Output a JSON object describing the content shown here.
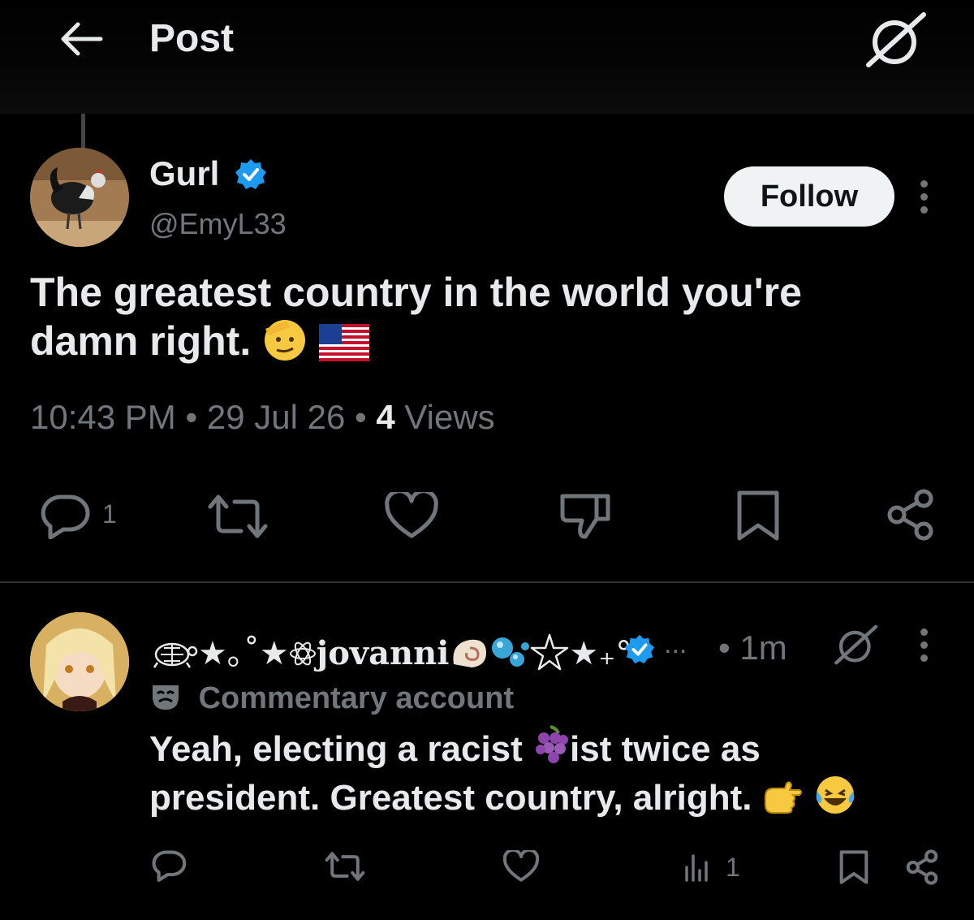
{
  "header": {
    "title": "Post",
    "back_icon": "arrow-left-icon",
    "grok_icon": "grok-icon"
  },
  "post": {
    "author_name": "Gurl",
    "handle": "@EmyL33",
    "verified": true,
    "follow_label": "Follow",
    "text_line1": "The greatest country in the world you're",
    "text_line2": "damn right.",
    "time": "10:43 PM",
    "date": "29 Jul 26",
    "views_count": "4",
    "views_label": "Views",
    "separator": "•",
    "reply_count": "1",
    "actions": [
      "reply-icon",
      "repost-icon",
      "like-icon",
      "dislike-icon",
      "bookmark-icon",
      "share-icon"
    ]
  },
  "reply": {
    "author_name": "jovanni",
    "name_prefix": "★｡˚★",
    "name_suffix": "★₊°",
    "ellipsis": "...",
    "time": "• 1m",
    "badge_label": "Commentary account",
    "text_line1a": "Yeah, electing a racist",
    "text_line1b": "ist twice as",
    "text_line2": "president. Greatest country, alright.",
    "views_count": "1",
    "actions": [
      "reply-icon",
      "repost-icon",
      "like-icon",
      "views-icon",
      "bookmark-icon",
      "share-icon"
    ]
  },
  "colors": {
    "background": "#000000",
    "text": "#e7e9ea",
    "secondary": "#71767b",
    "verified": "#1d9bf0",
    "follow_bg": "#eff3f4"
  }
}
